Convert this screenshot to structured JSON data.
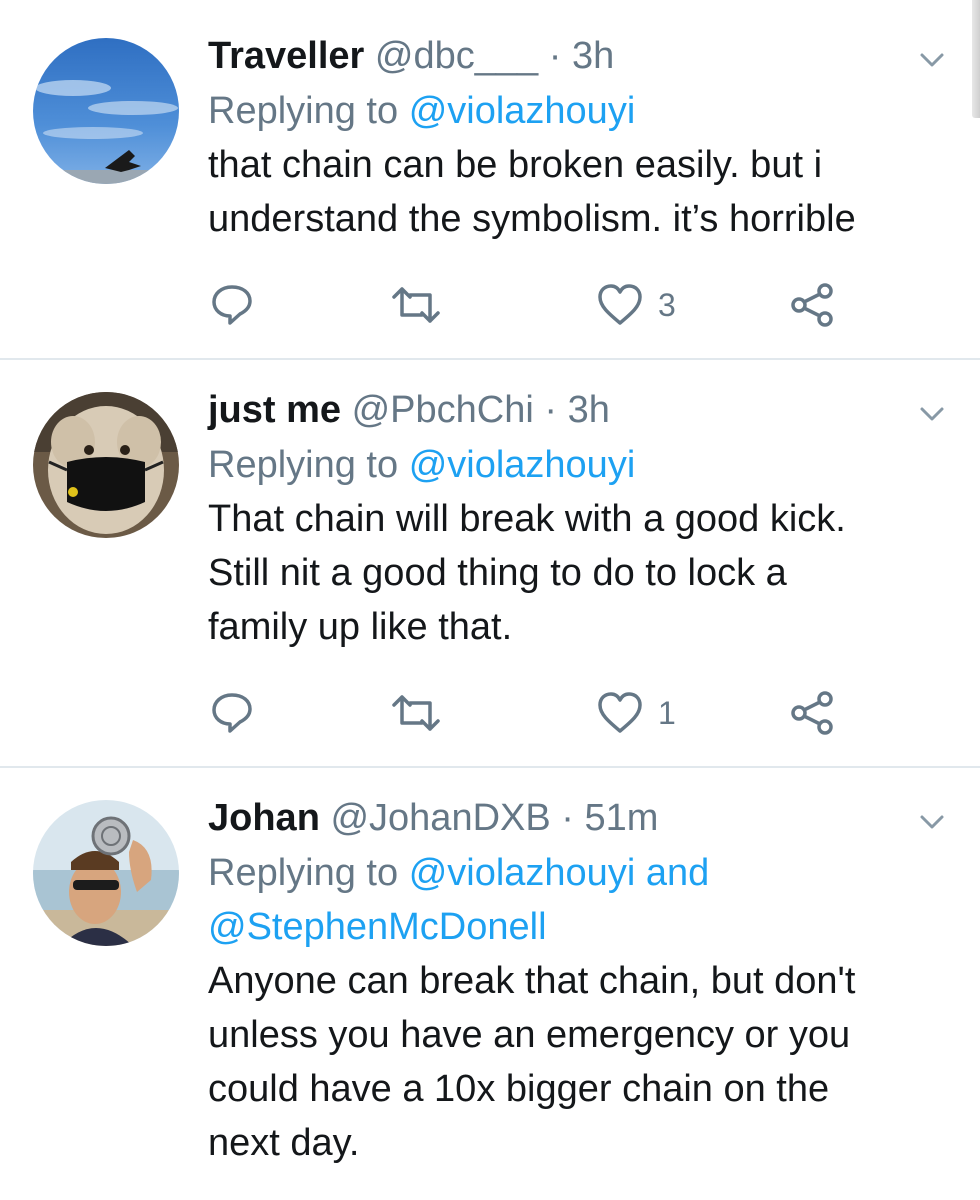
{
  "tweets": [
    {
      "name": "Traveller",
      "handle": "@dbc___",
      "time": "3h",
      "avatar": "sky-bird-avatar",
      "reply_prefix": "Replying to",
      "reply_mentions": "@violazhouyi",
      "reply_mentions_line2": "",
      "text_lines": [
        "that chain can be broken easily. but i",
        "understand the symbolism. it’s horrible"
      ],
      "likes": "3"
    },
    {
      "name": "just me",
      "handle": "@PbchChi",
      "time": "3h",
      "avatar": "dog-mask-avatar",
      "reply_prefix": "Replying to",
      "reply_mentions": "@violazhouyi",
      "reply_mentions_line2": "",
      "text_lines": [
        "That chain will break with a good kick.",
        "Still nit a good thing to do to lock a",
        "family up like that."
      ],
      "likes": "1"
    },
    {
      "name": "Johan",
      "handle": "@JohanDXB",
      "time": "51m",
      "avatar": "man-sunglasses-avatar",
      "reply_prefix": "Replying to",
      "reply_mentions": "@violazhouyi and",
      "reply_mentions_line2": "@StephenMcDonell",
      "text_lines": [
        "Anyone can break that chain, but don't",
        "unless you have an emergency or you",
        "could have a 10x bigger chain on the",
        "next day."
      ],
      "likes": ""
    }
  ],
  "colors": {
    "accent": "#1da1f2",
    "secondary_text": "#657786",
    "divider": "#e1e8ed",
    "icon": "#657786"
  },
  "icons": {
    "reply": "reply-icon",
    "retweet": "retweet-icon",
    "like": "heart-icon",
    "share": "share-icon",
    "menu": "chevron-down-icon"
  }
}
